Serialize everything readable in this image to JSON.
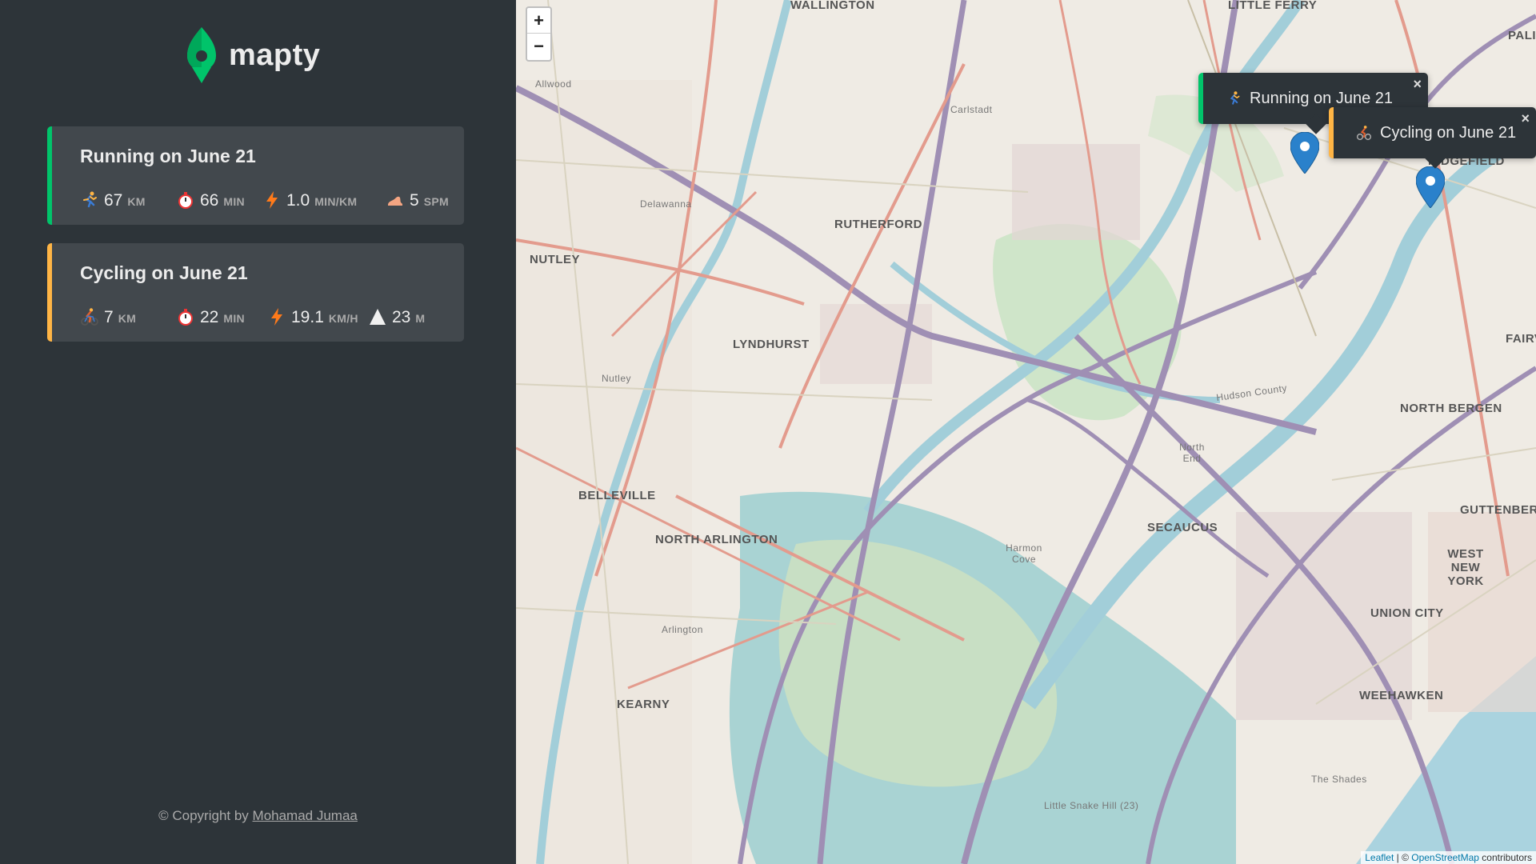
{
  "app": {
    "name": "mapty"
  },
  "workouts": [
    {
      "title": "Running on June 21",
      "type": "running",
      "distance": {
        "icon": "running-icon",
        "value": "67",
        "unit": "km"
      },
      "duration": {
        "icon": "stopwatch-icon",
        "value": "66",
        "unit": "min"
      },
      "pace": {
        "icon": "lightning-icon",
        "value": "1.0",
        "unit": "min/km"
      },
      "cadence": {
        "icon": "footprint-icon",
        "value": "5",
        "unit": "spm"
      }
    },
    {
      "title": "Cycling on June 21",
      "type": "cycling",
      "distance": {
        "icon": "cycling-icon",
        "value": "7",
        "unit": "km"
      },
      "duration": {
        "icon": "stopwatch-icon",
        "value": "22",
        "unit": "min"
      },
      "speed": {
        "icon": "lightning-icon",
        "value": "19.1",
        "unit": "km/h"
      },
      "elevation": {
        "icon": "mountain-icon",
        "value": "23",
        "unit": "m"
      }
    }
  ],
  "footer": {
    "prefix": "© Copyright by ",
    "author": "Mohamad Jumaa"
  },
  "map": {
    "zoom_in": "+",
    "zoom_out": "−",
    "popups": [
      {
        "text": "Running on June 21",
        "close": "×"
      },
      {
        "text": "Cycling on June 21",
        "close": "×"
      }
    ],
    "labels": {
      "wallington": "WALLINGTON",
      "little_ferry": "LITTLE FERRY",
      "palisades": "PALIS PA",
      "rutherford": "RUTHERFORD",
      "nutley": "NUTLEY",
      "lyndhurst": "LYNDHURST",
      "north_bergen": "NORTH BERGEN",
      "fairview": "FAIRV",
      "ridgefield": "RIDGEFIELD",
      "belleville": "BELLEVILLE",
      "north_arlington": "NORTH ARLINGTON",
      "secaucus": "SECAUCUS",
      "guttenberg": "GUTTENBERG",
      "west_new_york": "WEST NEW YORK",
      "union_city": "UNION CITY",
      "kearny": "KEARNY",
      "weehawken": "WEEHAWKEN",
      "carlstadt": "Carlstadt",
      "delawanna": "Delawanna",
      "allwood": "Allwood",
      "north_end": "North End",
      "harmon_cove": "Harmon Cove",
      "arlington": "Arlington",
      "the_shades": "The Shades",
      "little_snake_hill": "Little Snake Hill (23)",
      "hudson_county": "Hudson County",
      "nutley_small": "Nutley"
    },
    "attribution": {
      "leaflet": "Leaflet",
      "sep": " | © ",
      "osm": "OpenStreetMap",
      "suffix": " contributors"
    }
  },
  "colors": {
    "running_accent": "#00c46a",
    "cycling_accent": "#ffb545",
    "sidebar_bg": "#2d3439",
    "card_bg": "#42484d",
    "marker_blue": "#2a81cb"
  }
}
